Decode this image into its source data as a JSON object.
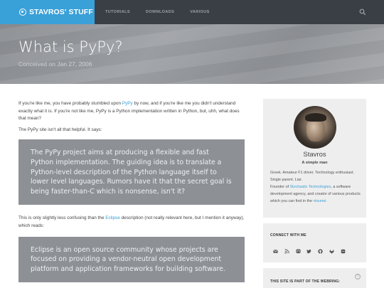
{
  "header": {
    "brand": "STAVROS' STUFF",
    "nav": [
      "TUTORIALS",
      "DOWNLOADS",
      "VARIOUS"
    ],
    "brand_color": "#3aa0d8",
    "nav_bg": "#3a3f45"
  },
  "hero": {
    "title": "What is PyPy?",
    "subtitle": "Conceived on Jan 27, 2006"
  },
  "article": {
    "p1_a": "If you're like me, you have probably stumbled upon ",
    "p1_link": "PyPy",
    "p1_b": " by now, and if you're like me you didn't understand exactly what it is. If you're not like me, PyPy is a Python implementation written in Python, but, uhh, what does that mean?",
    "p2": "The PyPy site isn't all that helpful. It says:",
    "quote1": "The PyPy project aims at producing a flexible and fast Python implementation. The guiding idea is to translate a Python-level description of the Python language itself to lower level languages. Rumors have it that the secret goal is being faster-than-C which is nonsense, isn't it?",
    "p3_a": "This is only slightly less confusing than the ",
    "p3_link": "Eclipse",
    "p3_b": " description (not really relevant here, but I mention it anyway), which reads:",
    "quote2": "Eclipse is an open source community whose projects are focused on providing a vendor-neutral open development platform and application frameworks for building software."
  },
  "sidebar": {
    "name": "Stavros",
    "tagline": "A simple man",
    "bio_a": "Greek. Amateur F1 driver. Technology enthusiast. Single parent. Liar.",
    "bio_b": "Founder of ",
    "bio_link1": "Stochastic Technologies",
    "bio_c": ", a software development agency, and creator of various products which you can find in the ",
    "bio_link2": "résumé",
    "bio_d": ".",
    "connect_heading": "CONNECT WITH ME",
    "social_icons": [
      "email-icon",
      "rss-icon",
      "mastodon-icon",
      "twitter-icon",
      "github-icon",
      "gitlab-icon",
      "keybase-icon"
    ],
    "webring_heading": "THIS SITE IS PART OF THE WEBRING:",
    "help_glyph": "?"
  }
}
